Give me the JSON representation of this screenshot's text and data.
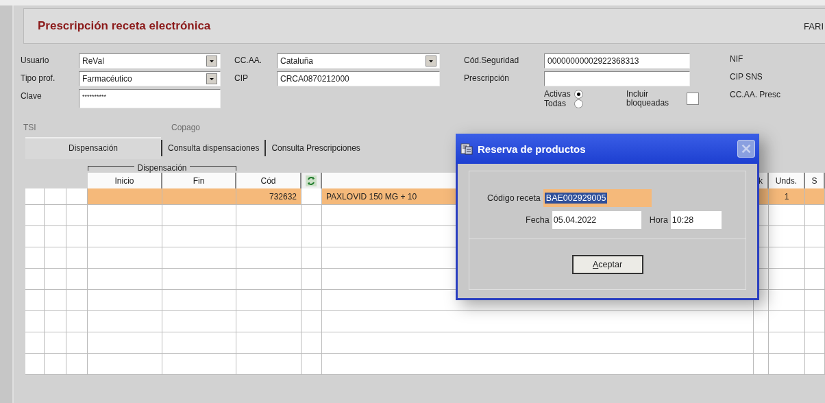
{
  "window": {
    "title": "Prescripción receta electrónica",
    "header_right": "FARI"
  },
  "form_left": [
    {
      "label": "Usuario",
      "kind": "dropdown",
      "value": "ReVal"
    },
    {
      "label": "Tipo prof.",
      "kind": "dropdown",
      "value": "Farmacéutico"
    },
    {
      "label": "Clave",
      "kind": "password",
      "value": "**********"
    }
  ],
  "form_mid": [
    {
      "label": "CC.AA.",
      "kind": "dropdown",
      "value": "Cataluña"
    },
    {
      "label": "CIP",
      "kind": "text",
      "value": "CRCA0870212000"
    }
  ],
  "form_right": [
    {
      "label": "Cód.Seguridad",
      "kind": "text",
      "value": "00000000002922368313"
    },
    {
      "label": "Prescripción",
      "kind": "text"
    }
  ],
  "filter_radios": [
    {
      "label": "Activas",
      "selected": true
    },
    {
      "label": "Todas",
      "selected": false
    }
  ],
  "include_blocked": {
    "label": "Incluir bloqueadas",
    "checked": false
  },
  "info_labels": [
    "NIF",
    "CIP SNS",
    "CC.AA. Presc"
  ],
  "disabled_labels": [
    "TSI",
    "Copago"
  ],
  "tabs": [
    {
      "label": "Dispensación",
      "selected": true
    },
    {
      "label": "Consulta dispensaciones",
      "selected": false
    },
    {
      "label": "Consulta Prescripciones",
      "selected": false
    }
  ],
  "grid": {
    "group_header": "Dispensación",
    "columns": [
      {
        "kind": "blank"
      },
      {
        "kind": "blank"
      },
      {
        "kind": "blank"
      },
      {
        "kind": "text",
        "label": "Inicio"
      },
      {
        "kind": "text",
        "label": "Fin"
      },
      {
        "kind": "text",
        "label": "Cód"
      },
      {
        "kind": "icon"
      },
      {
        "kind": "blank"
      },
      {
        "kind": "text",
        "label": "k"
      },
      {
        "kind": "text",
        "label": "Unds."
      },
      {
        "kind": "text",
        "label": "S"
      }
    ],
    "rows": [
      {
        "selected": true,
        "cells": [
          null,
          null,
          null,
          null,
          null,
          "732632",
          null,
          "PAXLOVID 150 MG + 10",
          null,
          "1",
          null
        ]
      }
    ]
  },
  "dialog": {
    "title": "Reserva de productos",
    "code": {
      "label": "Código receta",
      "value": "BAE002929005"
    },
    "date": {
      "label": "Fecha",
      "value": "05.04.2022"
    },
    "time": {
      "label": "Hora",
      "value": "10:28"
    },
    "button": "Aceptar"
  }
}
